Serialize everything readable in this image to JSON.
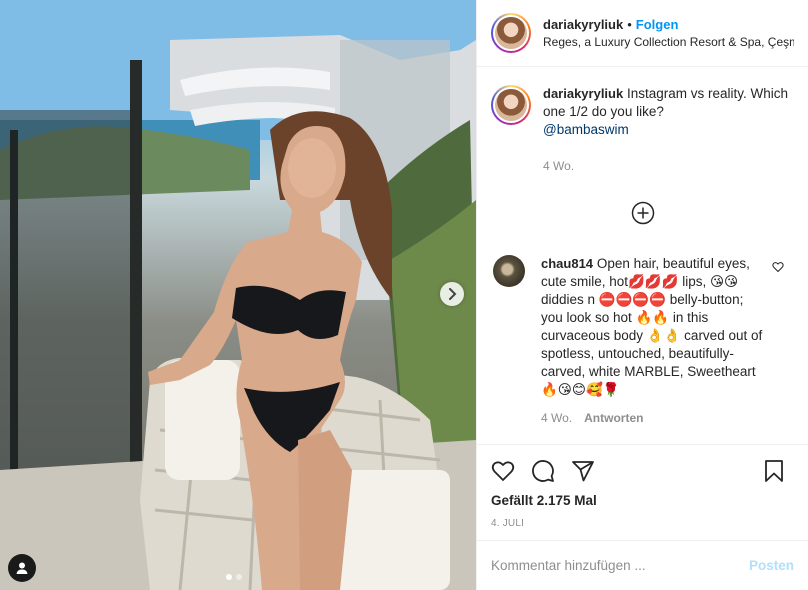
{
  "post": {
    "username": "dariakyryliuk",
    "separator": "•",
    "follow_label": "Folgen",
    "location": "Reges, a Luxury Collection Resort & Spa, Çeşme"
  },
  "caption": {
    "username": "dariakyryliuk",
    "text": "Instagram vs reality. Which one 1/2 do you like?",
    "mention": "@bambaswim",
    "age": "4 Wo."
  },
  "comment": {
    "username": "chau814",
    "text": "Open hair, beautiful eyes, cute smile, hot💋💋💋 lips, 😘😘 diddies n ⛔⛔⛔⛔ belly-button; you look so hot 🔥🔥 in this curvaceous body 👌👌 carved out of spotless, untouched, beautifully-carved, white MARBLE, Sweetheart 🔥😘😊🥰🌹",
    "age": "4 Wo.",
    "reply_label": "Antworten"
  },
  "actions": {
    "likes": "Gefällt 2.175 Mal",
    "date": "4. JULI"
  },
  "composer": {
    "placeholder": "Kommentar hinzufügen ...",
    "post_label": "Posten"
  },
  "carousel": {
    "slides": 2,
    "current": 1
  },
  "icons": [
    "chevron-right-icon",
    "user-tag-icon",
    "plus-circle-icon",
    "heart-icon",
    "comment-icon",
    "share-icon",
    "bookmark-icon"
  ],
  "colors": {
    "link": "#0095f6",
    "mention": "#00376b",
    "muted": "#8e8e8e",
    "post_disabled": "#b2dffc"
  }
}
